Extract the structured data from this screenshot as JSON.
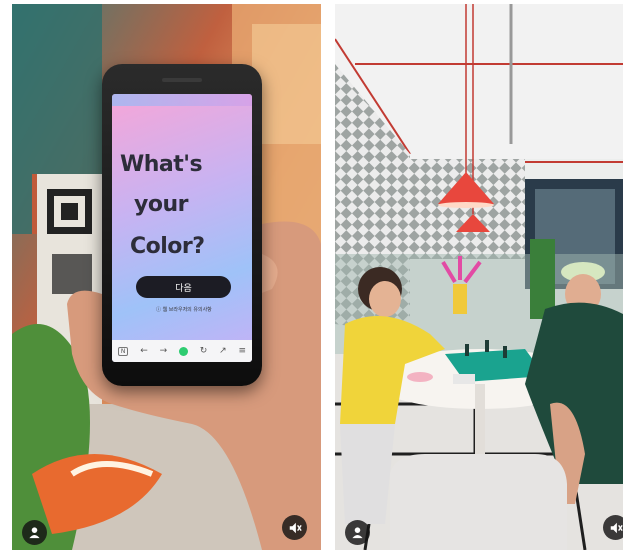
{
  "left_card": {
    "phone_screen": {
      "headline_lines": [
        "What's",
        "your",
        "Color?"
      ],
      "next_button_label": "다음",
      "footnote": "ⓘ 웹 브라우저의 유의사항",
      "browser_bar": {
        "tab_label": "N",
        "back_icon": "←",
        "forward_icon": "→",
        "refresh_icon": "↻",
        "share_icon": "↗",
        "menu_icon": "≡"
      }
    },
    "profile_icon": "user-icon",
    "mute_icon": "mute-icon"
  },
  "right_card": {
    "profile_icon": "user-icon",
    "mute_icon": "mute-icon"
  },
  "colors": {
    "overlay_button": "#141414",
    "phone_gradient_start": "#f6a6d8",
    "phone_gradient_end": "#9fc2f8",
    "lamp_red": "#e8473d",
    "chess_teal": "#1aa38f"
  }
}
